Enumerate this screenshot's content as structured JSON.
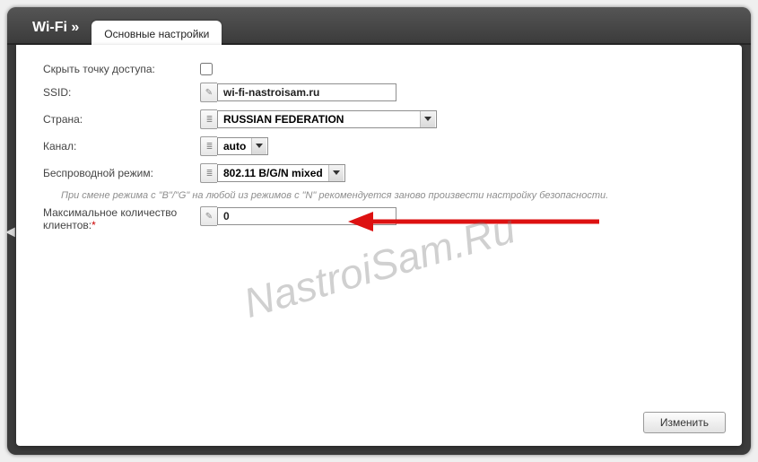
{
  "header": {
    "breadcrumb": "Wi-Fi »",
    "tab": "Основные настройки"
  },
  "fields": {
    "hide_ap": {
      "label": "Скрыть точку доступа:"
    },
    "ssid": {
      "label": "SSID:",
      "value": "wi-fi-nastroisam.ru"
    },
    "country": {
      "label": "Страна:",
      "value": "RUSSIAN FEDERATION"
    },
    "channel": {
      "label": "Канал:",
      "value": "auto"
    },
    "mode": {
      "label": "Беспроводной режим:",
      "value": "802.11 B/G/N mixed"
    },
    "hint": "При смене режима с \"B\"/\"G\" на любой из режимов с \"N\" рекомендуется заново произвести настройку безопасности.",
    "max_clients": {
      "label_line1": "Максимальное количество",
      "label_line2": "клиентов:",
      "value": "0"
    }
  },
  "buttons": {
    "apply": "Изменить"
  },
  "watermark": "NastroiSam.Ru"
}
